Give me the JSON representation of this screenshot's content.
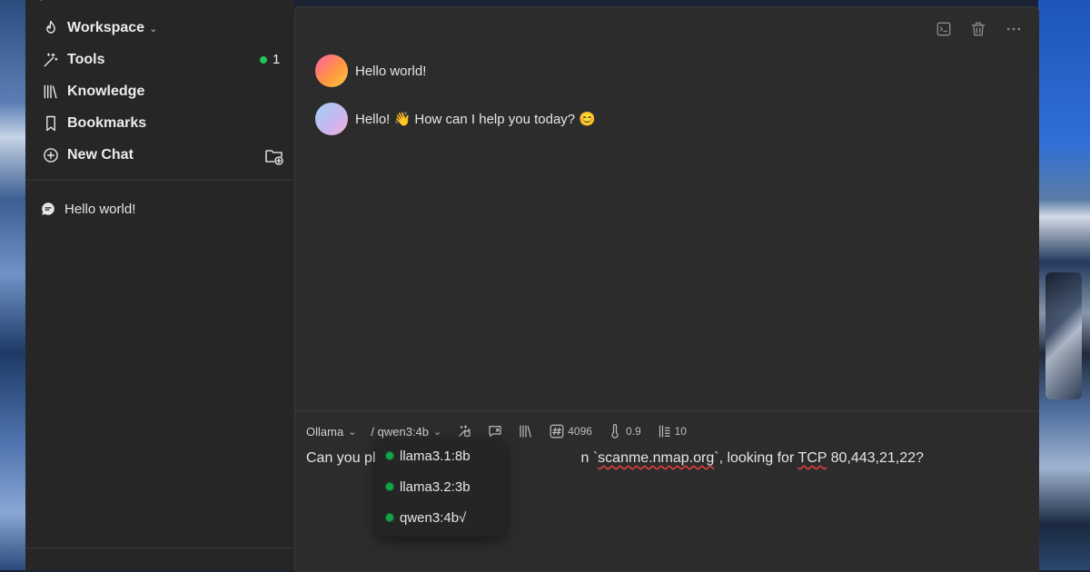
{
  "sidebar": {
    "nav": [
      {
        "label": "Workspace",
        "icon": "flame-icon",
        "has_chevron": true
      },
      {
        "label": "Tools",
        "icon": "magic-wand-icon"
      },
      {
        "label": "Knowledge",
        "icon": "books-icon"
      },
      {
        "label": "Bookmarks",
        "icon": "bookmark-icon"
      },
      {
        "label": "New Chat",
        "icon": "plus-circle-icon"
      }
    ],
    "tools_count": "1",
    "chats": [
      {
        "title": "Hello world!",
        "icon": "chat-bubble-icon"
      }
    ]
  },
  "conversation": {
    "messages": [
      {
        "role": "user",
        "text": "Hello world!"
      },
      {
        "role": "assistant",
        "text": "Hello! 👋 How can I help you today? 😊"
      }
    ]
  },
  "toolbar": {
    "provider": "Ollama",
    "model": "/ qwen3:4b",
    "context_length": "4096",
    "temperature": "0.9",
    "top_k": "10"
  },
  "prompt": {
    "part1": "Can you pl",
    "part2": "n `",
    "host": "scanme.nmap.org",
    "part3": "`, looking for ",
    "proto": "TCP",
    "ports": " 80,443,21,22?"
  },
  "model_dropdown": {
    "options": [
      "llama3.1:8b",
      "llama3.2:3b",
      "qwen3:4b√"
    ]
  },
  "colors": {
    "status_green": "#22c55e",
    "sidebar_bg": "#262626",
    "main_bg": "#2c2c2c"
  }
}
